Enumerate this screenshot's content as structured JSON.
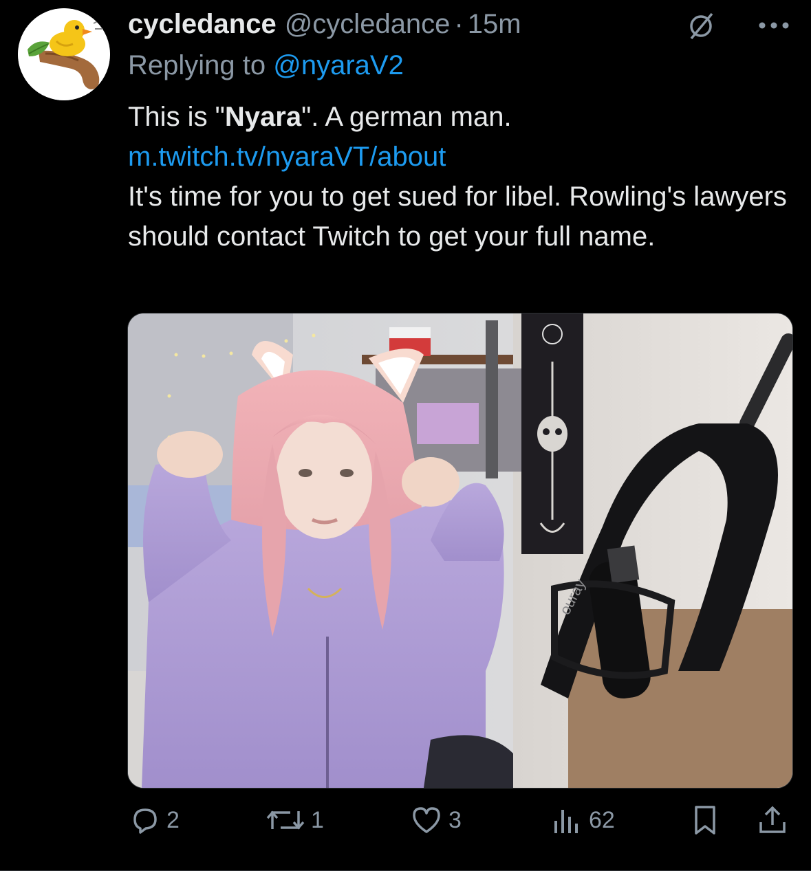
{
  "tweet": {
    "display_name": "cycledance",
    "handle": "@cycledance",
    "separator": "·",
    "time": "15m",
    "replying_prefix": "Replying to",
    "replying_to": "@nyaraV2",
    "line1_before": "This is \"",
    "line1_bold": "Nyara",
    "line1_after": "\". A german man.",
    "link": "m.twitch.tv/nyaraVT/about",
    "line3": "It's time for you to get sued for libel. Rowling's lawyers should contact Twitch to get your full name."
  },
  "media": {
    "mic_brand": "ouray"
  },
  "actions": {
    "replies": "2",
    "reposts": "1",
    "likes": "3",
    "views": "62"
  },
  "colors": {
    "background": "#000000",
    "text": "#e7e9ea",
    "muted": "#8b98a5",
    "link": "#1d9bf0"
  },
  "icons": [
    "duck-avatar-icon",
    "grok-icon",
    "more-icon",
    "reply-icon",
    "repost-icon",
    "like-icon",
    "views-icon",
    "bookmark-icon",
    "share-icon"
  ]
}
